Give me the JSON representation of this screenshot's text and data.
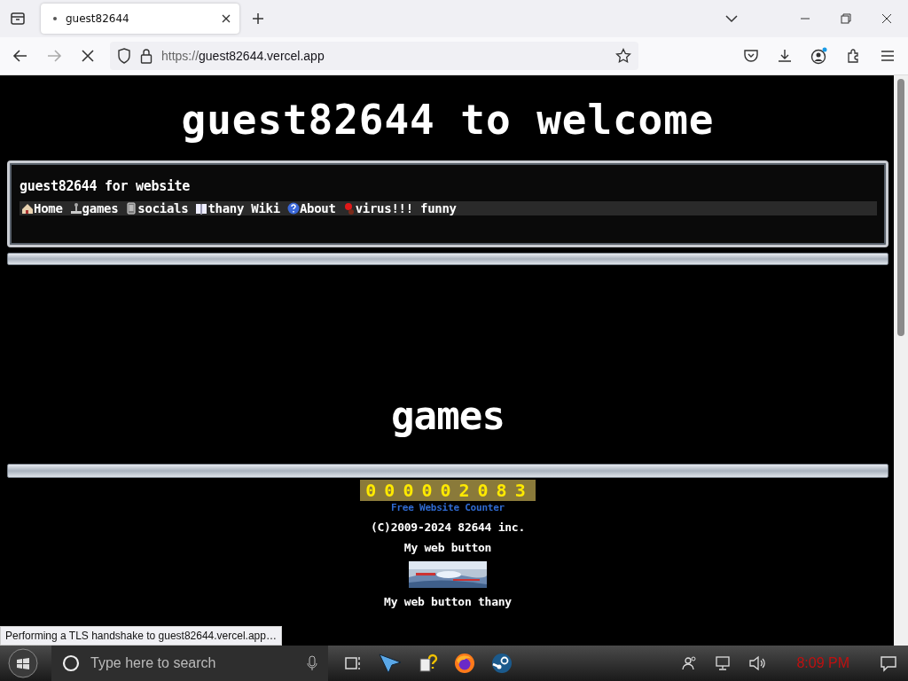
{
  "browser": {
    "tabs": [
      {
        "title": "guest82644",
        "selected": true
      }
    ],
    "url_scheme": "https://",
    "url_host": "guest82644.vercel.app",
    "loading": true
  },
  "page": {
    "heading": "guest82644 to welcome",
    "panel_title": "guest82644 for website",
    "nav": [
      {
        "label": "Home"
      },
      {
        "label": "games"
      },
      {
        "label": "socials"
      },
      {
        "label": "thany Wiki"
      },
      {
        "label": "About"
      },
      {
        "label": "virus!!! funny"
      }
    ],
    "section_heading": "games",
    "counter": "000002083",
    "counter_caption": "Free Website Counter",
    "copyright": "(C)2009-2024 82644 inc.",
    "button_label": "My web button",
    "button_caption": "My web button thany"
  },
  "status": "Performing a TLS handshake to guest82644.vercel.app…",
  "taskbar": {
    "search_placeholder": "Type here to search",
    "clock": "8:09 PM"
  }
}
